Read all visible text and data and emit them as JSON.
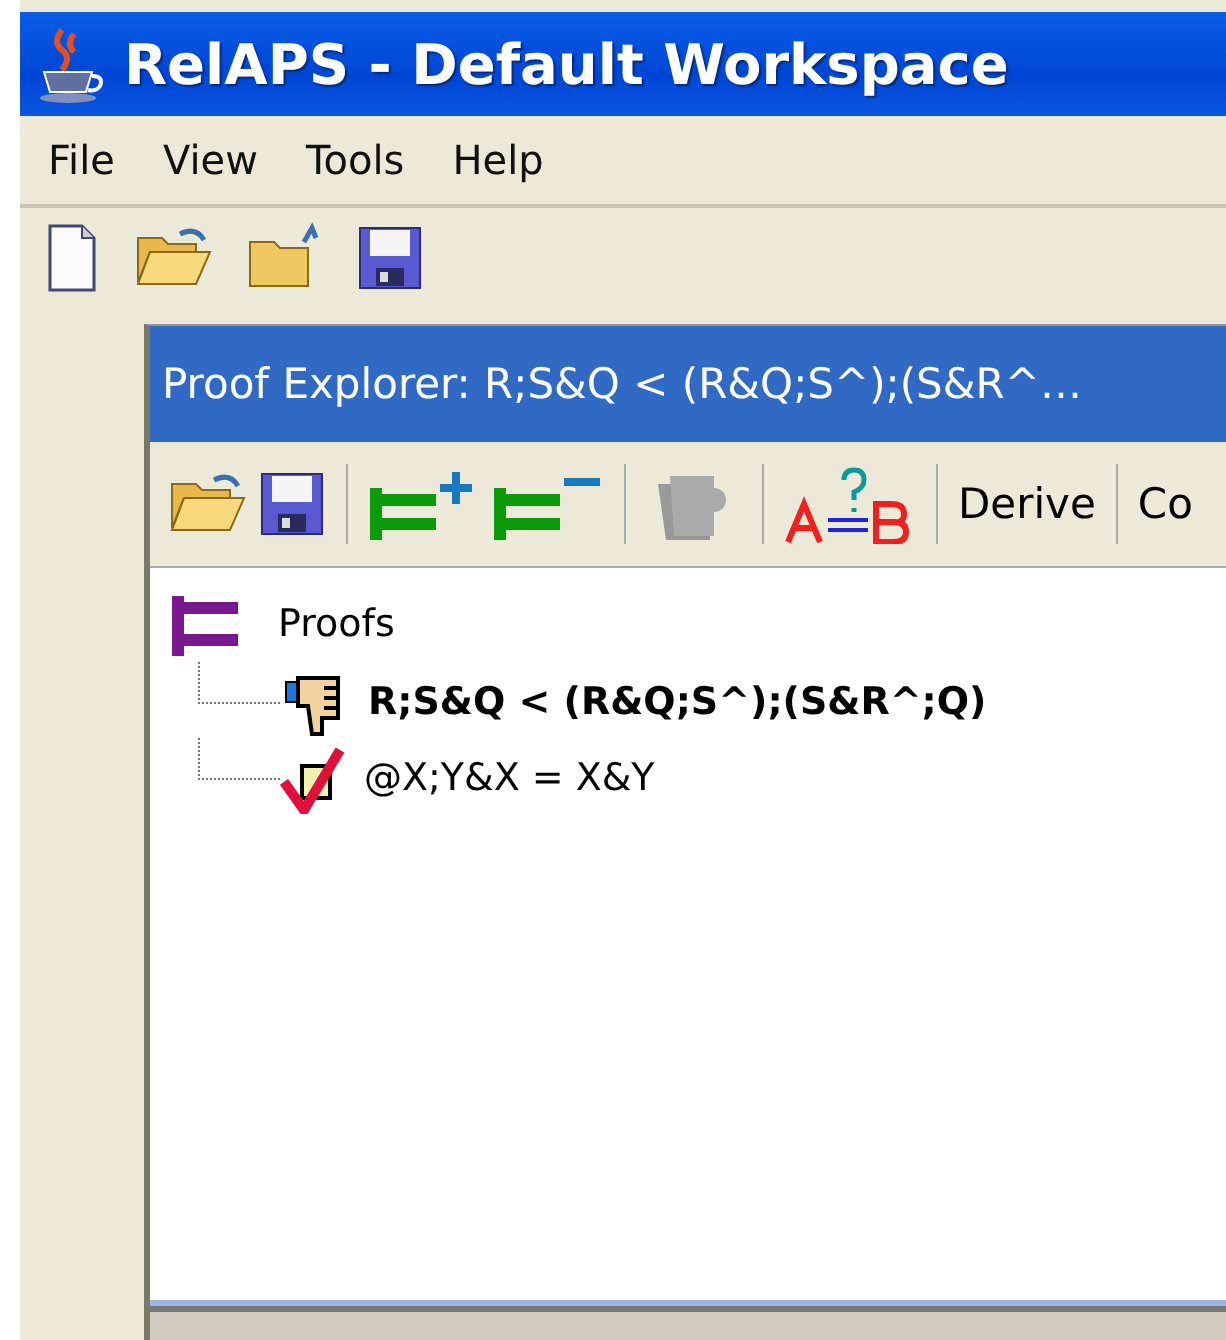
{
  "window": {
    "title": "RelAPS - Default Workspace"
  },
  "menu": [
    "File",
    "View",
    "Tools",
    "Help"
  ],
  "proof_explorer": {
    "title": "Proof Explorer: R;S&Q < (R&Q;S^);(S&R^…",
    "toolbar_buttons": [
      "Derive",
      "Co"
    ],
    "tree": {
      "label": "Proofs",
      "children": [
        {
          "label": "R;S&Q < (R&Q;S^);(S&R^;Q)",
          "kind": "failed"
        },
        {
          "label": "@X;Y&X = X&Y",
          "kind": "proved"
        }
      ]
    }
  }
}
